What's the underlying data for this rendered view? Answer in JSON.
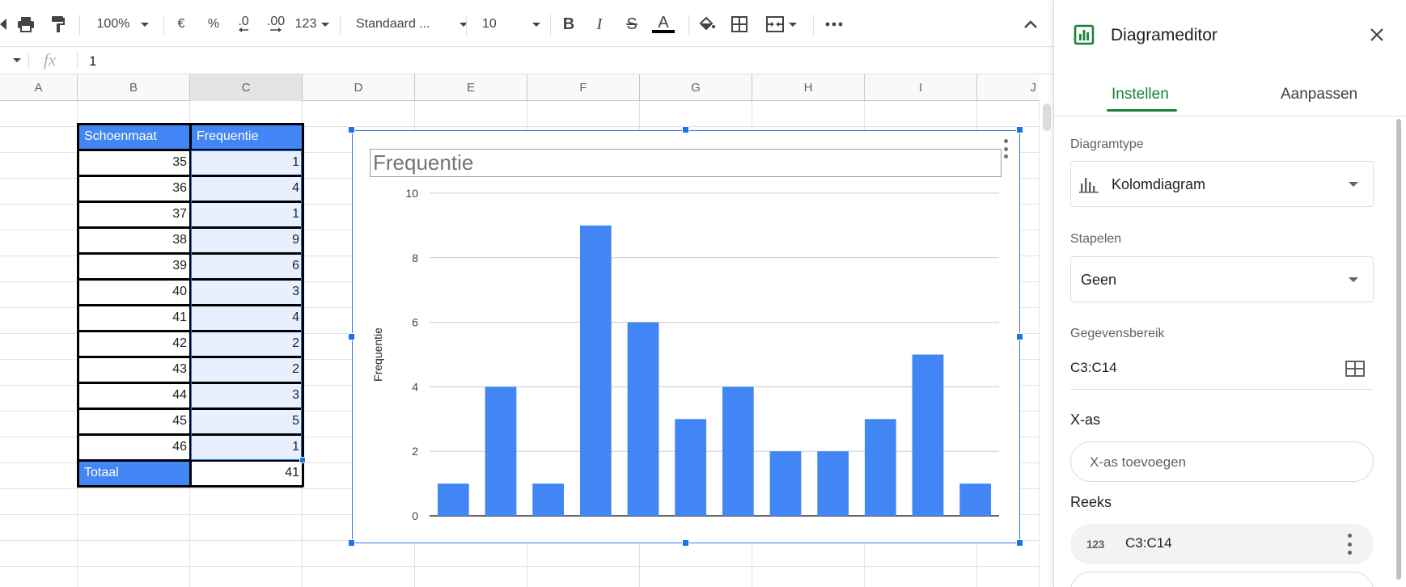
{
  "toolbar": {
    "zoom": "100%",
    "currency": "€",
    "percent": "%",
    "decrease_decimals": ".0",
    "increase_decimals": ".00",
    "number_format": "123",
    "font": "Standaard ...",
    "font_size": "10",
    "bold": "B",
    "italic": "I",
    "strikethrough": "S",
    "text_color": "A"
  },
  "formula_bar": {
    "fx": "fx",
    "value": "1"
  },
  "columns": [
    "A",
    "B",
    "C",
    "D",
    "E",
    "F",
    "G",
    "H",
    "I",
    "J"
  ],
  "table": {
    "headers": [
      "Schoenmaat",
      "Frequentie"
    ],
    "rows": [
      {
        "size": "35",
        "freq": "1"
      },
      {
        "size": "36",
        "freq": "4"
      },
      {
        "size": "37",
        "freq": "1"
      },
      {
        "size": "38",
        "freq": "9"
      },
      {
        "size": "39",
        "freq": "6"
      },
      {
        "size": "40",
        "freq": "3"
      },
      {
        "size": "41",
        "freq": "4"
      },
      {
        "size": "42",
        "freq": "2"
      },
      {
        "size": "43",
        "freq": "2"
      },
      {
        "size": "44",
        "freq": "3"
      },
      {
        "size": "45",
        "freq": "5"
      },
      {
        "size": "46",
        "freq": "1"
      }
    ],
    "total_label": "Totaal",
    "total_value": "41"
  },
  "chart_data": {
    "type": "bar",
    "title": "Frequentie",
    "xlabel": "",
    "ylabel": "Frequentie",
    "values": [
      1,
      4,
      1,
      9,
      6,
      3,
      4,
      2,
      2,
      3,
      5,
      1
    ],
    "ylim": [
      0,
      10
    ],
    "yticks": [
      "0",
      "2",
      "4",
      "6",
      "8",
      "10"
    ],
    "color": "#4285f4",
    "grid": true
  },
  "sidebar": {
    "title": "Diagrameditor",
    "tabs": [
      "Instellen",
      "Aanpassen"
    ],
    "chart_type_label": "Diagramtype",
    "chart_type_value": "Kolomdiagram",
    "stacking_label": "Stapelen",
    "stacking_value": "Geen",
    "range_label": "Gegevensbereik",
    "range_value": "C3:C14",
    "xaxis_label": "X-as",
    "xaxis_add": "X-as toevoegen",
    "series_label": "Reeks",
    "series_badge": "123",
    "series_value": "C3:C14"
  },
  "colors": {
    "accent_green": "#188038",
    "header_blue": "#4285f4",
    "selection_blue": "#1a73e8"
  }
}
